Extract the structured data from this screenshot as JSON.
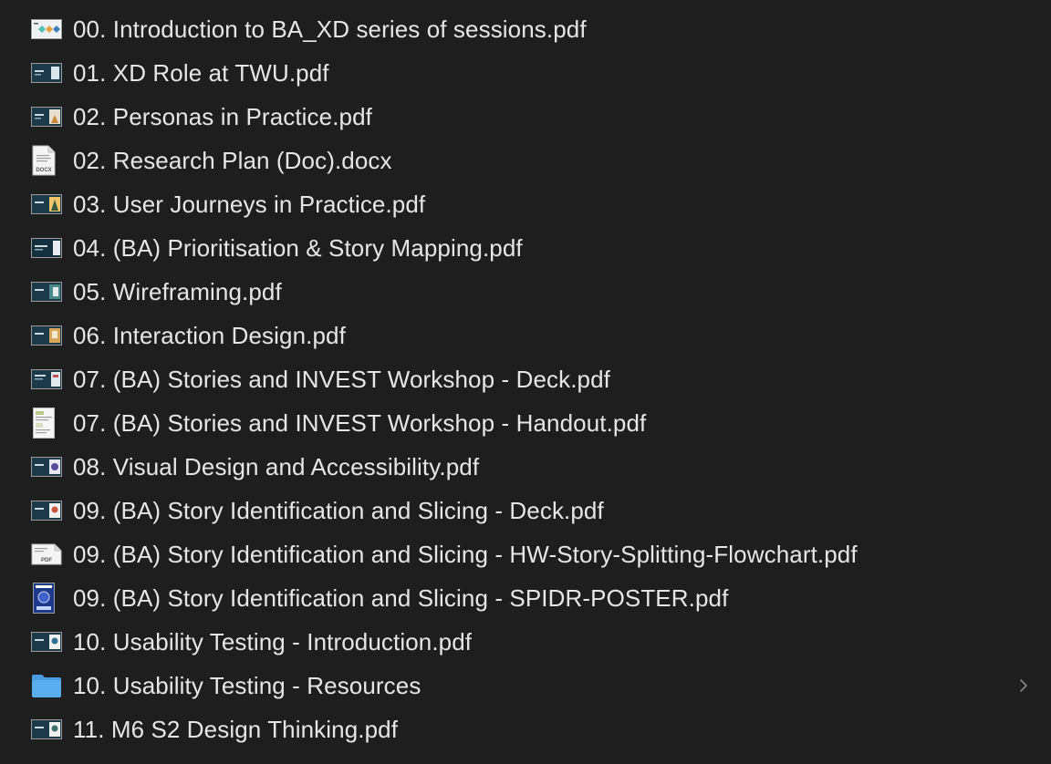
{
  "files": [
    {
      "name": "00. Introduction to BA_XD series of sessions.pdf",
      "icon": "pdf-light-thumbnail-icon"
    },
    {
      "name": "01. XD Role at TWU.pdf",
      "icon": "pdf-slide-thumbnail-icon"
    },
    {
      "name": "02. Personas in Practice.pdf",
      "icon": "pdf-slide-thumbnail-icon"
    },
    {
      "name": "02. Research Plan (Doc).docx",
      "icon": "docx-document-icon",
      "icon_label": "DOCX"
    },
    {
      "name": "03. User Journeys in Practice.pdf",
      "icon": "pdf-slide-thumbnail-icon"
    },
    {
      "name": "04. (BA) Prioritisation & Story Mapping.pdf",
      "icon": "pdf-slide-thumbnail-icon"
    },
    {
      "name": "05. Wireframing.pdf",
      "icon": "pdf-slide-thumbnail-icon"
    },
    {
      "name": "06. Interaction Design.pdf",
      "icon": "pdf-slide-thumbnail-icon"
    },
    {
      "name": "07. (BA) Stories and INVEST Workshop - Deck.pdf",
      "icon": "pdf-slide-thumbnail-icon"
    },
    {
      "name": "07. (BA) Stories and INVEST Workshop - Handout.pdf",
      "icon": "pdf-handout-thumbnail-icon"
    },
    {
      "name": "08. Visual Design and Accessibility.pdf",
      "icon": "pdf-slide-thumbnail-icon"
    },
    {
      "name": "09. (BA) Story Identification and Slicing - Deck.pdf",
      "icon": "pdf-slide-thumbnail-icon"
    },
    {
      "name": "09. (BA) Story Identification and Slicing - HW-Story-Splitting-Flowchart.pdf",
      "icon": "pdf-document-icon",
      "icon_label": "PDF"
    },
    {
      "name": "09. (BA) Story Identification and Slicing - SPIDR-POSTER.pdf",
      "icon": "pdf-poster-thumbnail-icon"
    },
    {
      "name": "10. Usability Testing - Introduction.pdf",
      "icon": "pdf-slide-thumbnail-icon"
    },
    {
      "name": "10. Usability Testing - Resources",
      "icon": "folder-icon",
      "is_folder": true
    },
    {
      "name": "11. M6 S2 Design Thinking.pdf",
      "icon": "pdf-slide-thumbnail-icon"
    }
  ],
  "colors": {
    "background": "#1e1e1e",
    "text": "#e6e6e6",
    "folder": "#5aaef0",
    "slide_dark": "#1c3a4a",
    "chevron": "#8a8a8a"
  }
}
